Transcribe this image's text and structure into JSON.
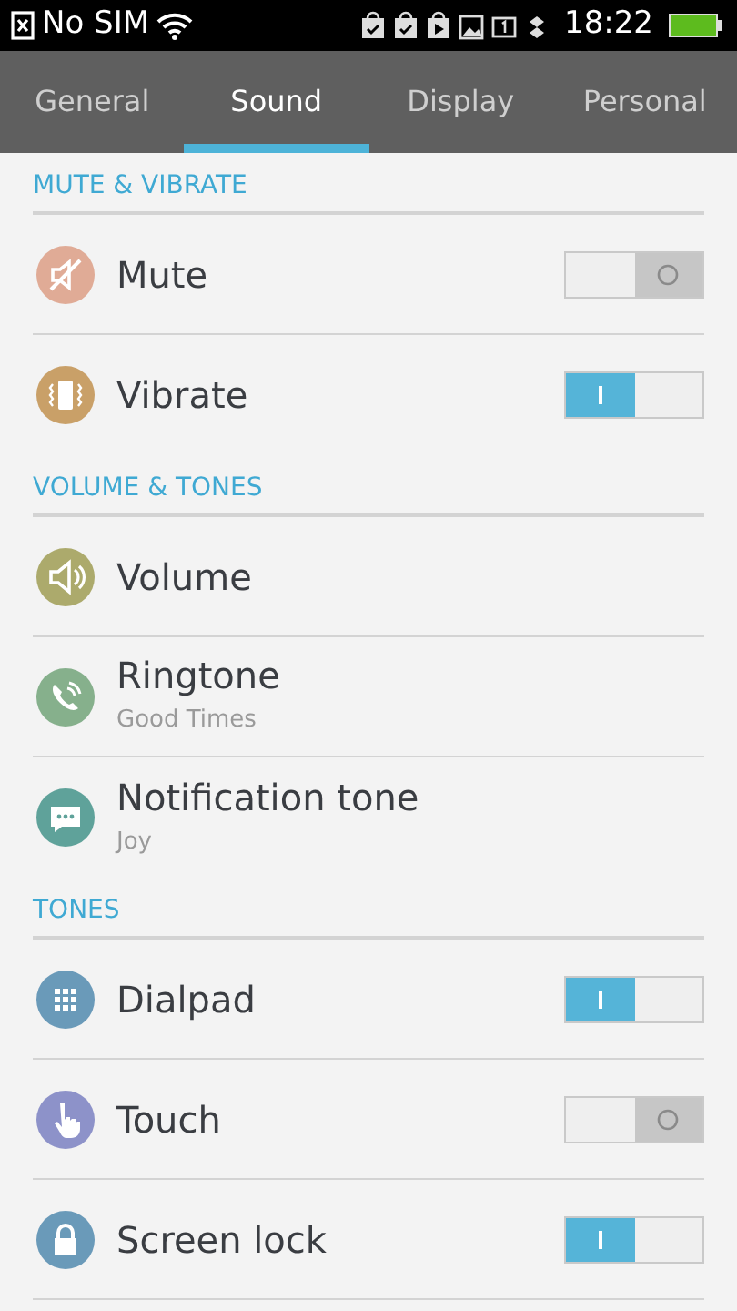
{
  "status_bar": {
    "carrier": "No SIM",
    "time": "18:22"
  },
  "tabs": [
    {
      "label": "General",
      "selected": false
    },
    {
      "label": "Sound",
      "selected": true
    },
    {
      "label": "Display",
      "selected": false
    },
    {
      "label": "Personal",
      "selected": false
    }
  ],
  "sections": [
    {
      "title": "MUTE & VIBRATE",
      "items": [
        {
          "kind": "switch",
          "label": "Mute",
          "on": false
        },
        {
          "kind": "switch",
          "label": "Vibrate",
          "on": true
        }
      ]
    },
    {
      "title": "VOLUME & TONES",
      "items": [
        {
          "kind": "link",
          "label": "Volume"
        },
        {
          "kind": "link",
          "label": "Ringtone",
          "summary": "Good Times"
        },
        {
          "kind": "link",
          "label": "Notification tone",
          "summary": "Joy"
        }
      ]
    },
    {
      "title": "TONES",
      "items": [
        {
          "kind": "switch",
          "label": "Dialpad",
          "on": true
        },
        {
          "kind": "switch",
          "label": "Touch",
          "on": false
        },
        {
          "kind": "switch",
          "label": "Screen lock",
          "on": true
        }
      ]
    }
  ]
}
